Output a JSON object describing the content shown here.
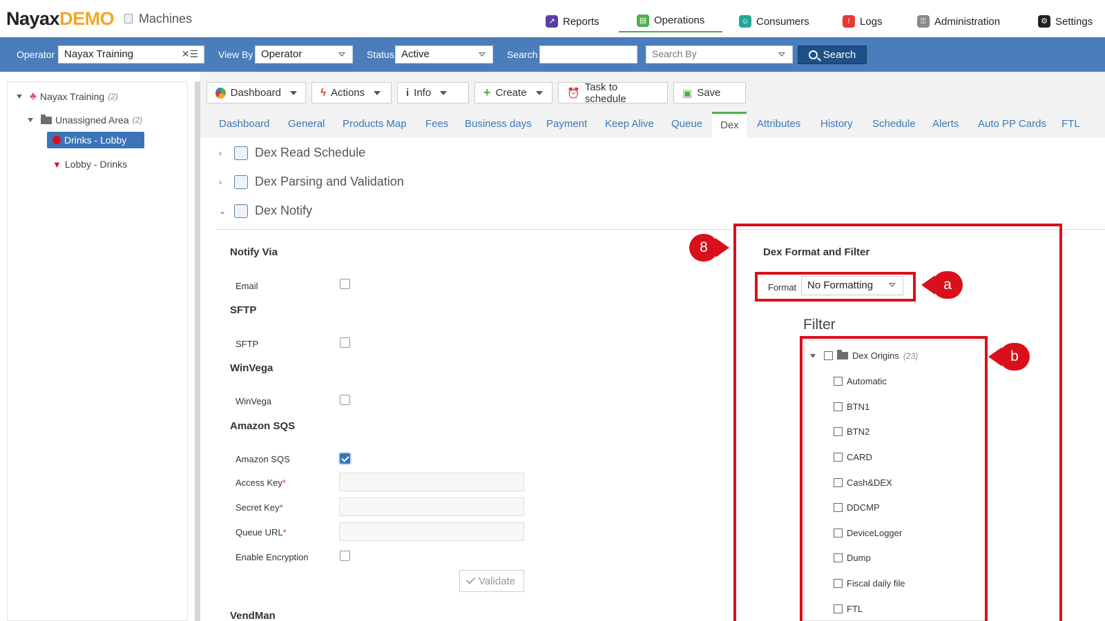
{
  "header": {
    "logo_main": "Nayax",
    "logo_demo": "DEMO",
    "module_title": "Machines",
    "nav": [
      {
        "label": "Reports",
        "icon": "reports-icon",
        "color": "#5a3fa0"
      },
      {
        "label": "Operations",
        "icon": "operations-icon",
        "color": "#4caf50",
        "active": true
      },
      {
        "label": "Consumers",
        "icon": "consumers-icon",
        "color": "#26a69a"
      },
      {
        "label": "Logs",
        "icon": "logs-icon",
        "color": "#e53935"
      },
      {
        "label": "Administration",
        "icon": "administration-icon",
        "color": "#888888"
      },
      {
        "label": "Settings",
        "icon": "settings-icon",
        "color": "#222222"
      }
    ]
  },
  "filterbar": {
    "operator_label": "Operator",
    "operator_value": "Nayax Training",
    "viewby_label": "View By",
    "viewby_value": "Operator",
    "status_label": "Status",
    "status_value": "Active",
    "search_label": "Search",
    "search_value": "",
    "searchby_placeholder": "Search By",
    "search_button": "Search",
    "bar_color": "#4a7dba"
  },
  "tree": {
    "root": {
      "label": "Nayax Training",
      "count": "(2)"
    },
    "area": {
      "label": "Unassigned Area",
      "count": "(2)"
    },
    "machines": [
      {
        "label": "Drinks - Lobby",
        "selected": true
      },
      {
        "label": "Lobby - Drinks",
        "selected": false
      }
    ]
  },
  "toolbar": {
    "dashboard": "Dashboard",
    "actions": "Actions",
    "info": "Info",
    "create": "Create",
    "task": "Task to schedule",
    "save": "Save"
  },
  "tabs": [
    "Dashboard",
    "General",
    "Products Map",
    "Fees",
    "Business days",
    "Payment",
    "Keep Alive",
    "Queue",
    "Dex",
    "Attributes",
    "History",
    "Schedule",
    "Alerts",
    "Auto PP Cards",
    "FTL"
  ],
  "active_tab": "Dex",
  "sections": {
    "read_schedule": "Dex Read Schedule",
    "parsing": "Dex Parsing and Validation",
    "notify": "Dex Notify"
  },
  "notify": {
    "notify_via": "Notify Via",
    "email": "Email",
    "sftp_h": "SFTP",
    "sftp": "SFTP",
    "winvega_h": "WinVega",
    "winvega": "WinVega",
    "sqs_h": "Amazon SQS",
    "sqs": "Amazon SQS",
    "sqs_checked": true,
    "access_key": "Access Key",
    "secret_key": "Secret Key",
    "queue_url": "Queue URL",
    "required_mark": "*",
    "encryption": "Enable Encryption",
    "validate": "Validate",
    "vendman_h": "VendMan"
  },
  "format_filter": {
    "title": "Dex Format and Filter",
    "format_label": "Format",
    "format_value": "No Formatting",
    "filter_title": "Filter",
    "origins_label": "Dex Origins",
    "origins_count": "(23)",
    "origins": [
      "Automatic",
      "BTN1",
      "BTN2",
      "CARD",
      "Cash&DEX",
      "DDCMP",
      "DeviceLogger",
      "Dump",
      "Fiscal daily file",
      "FTL"
    ]
  },
  "callouts": {
    "main": "8",
    "a": "a",
    "b": "b",
    "color": "#d9101b"
  }
}
